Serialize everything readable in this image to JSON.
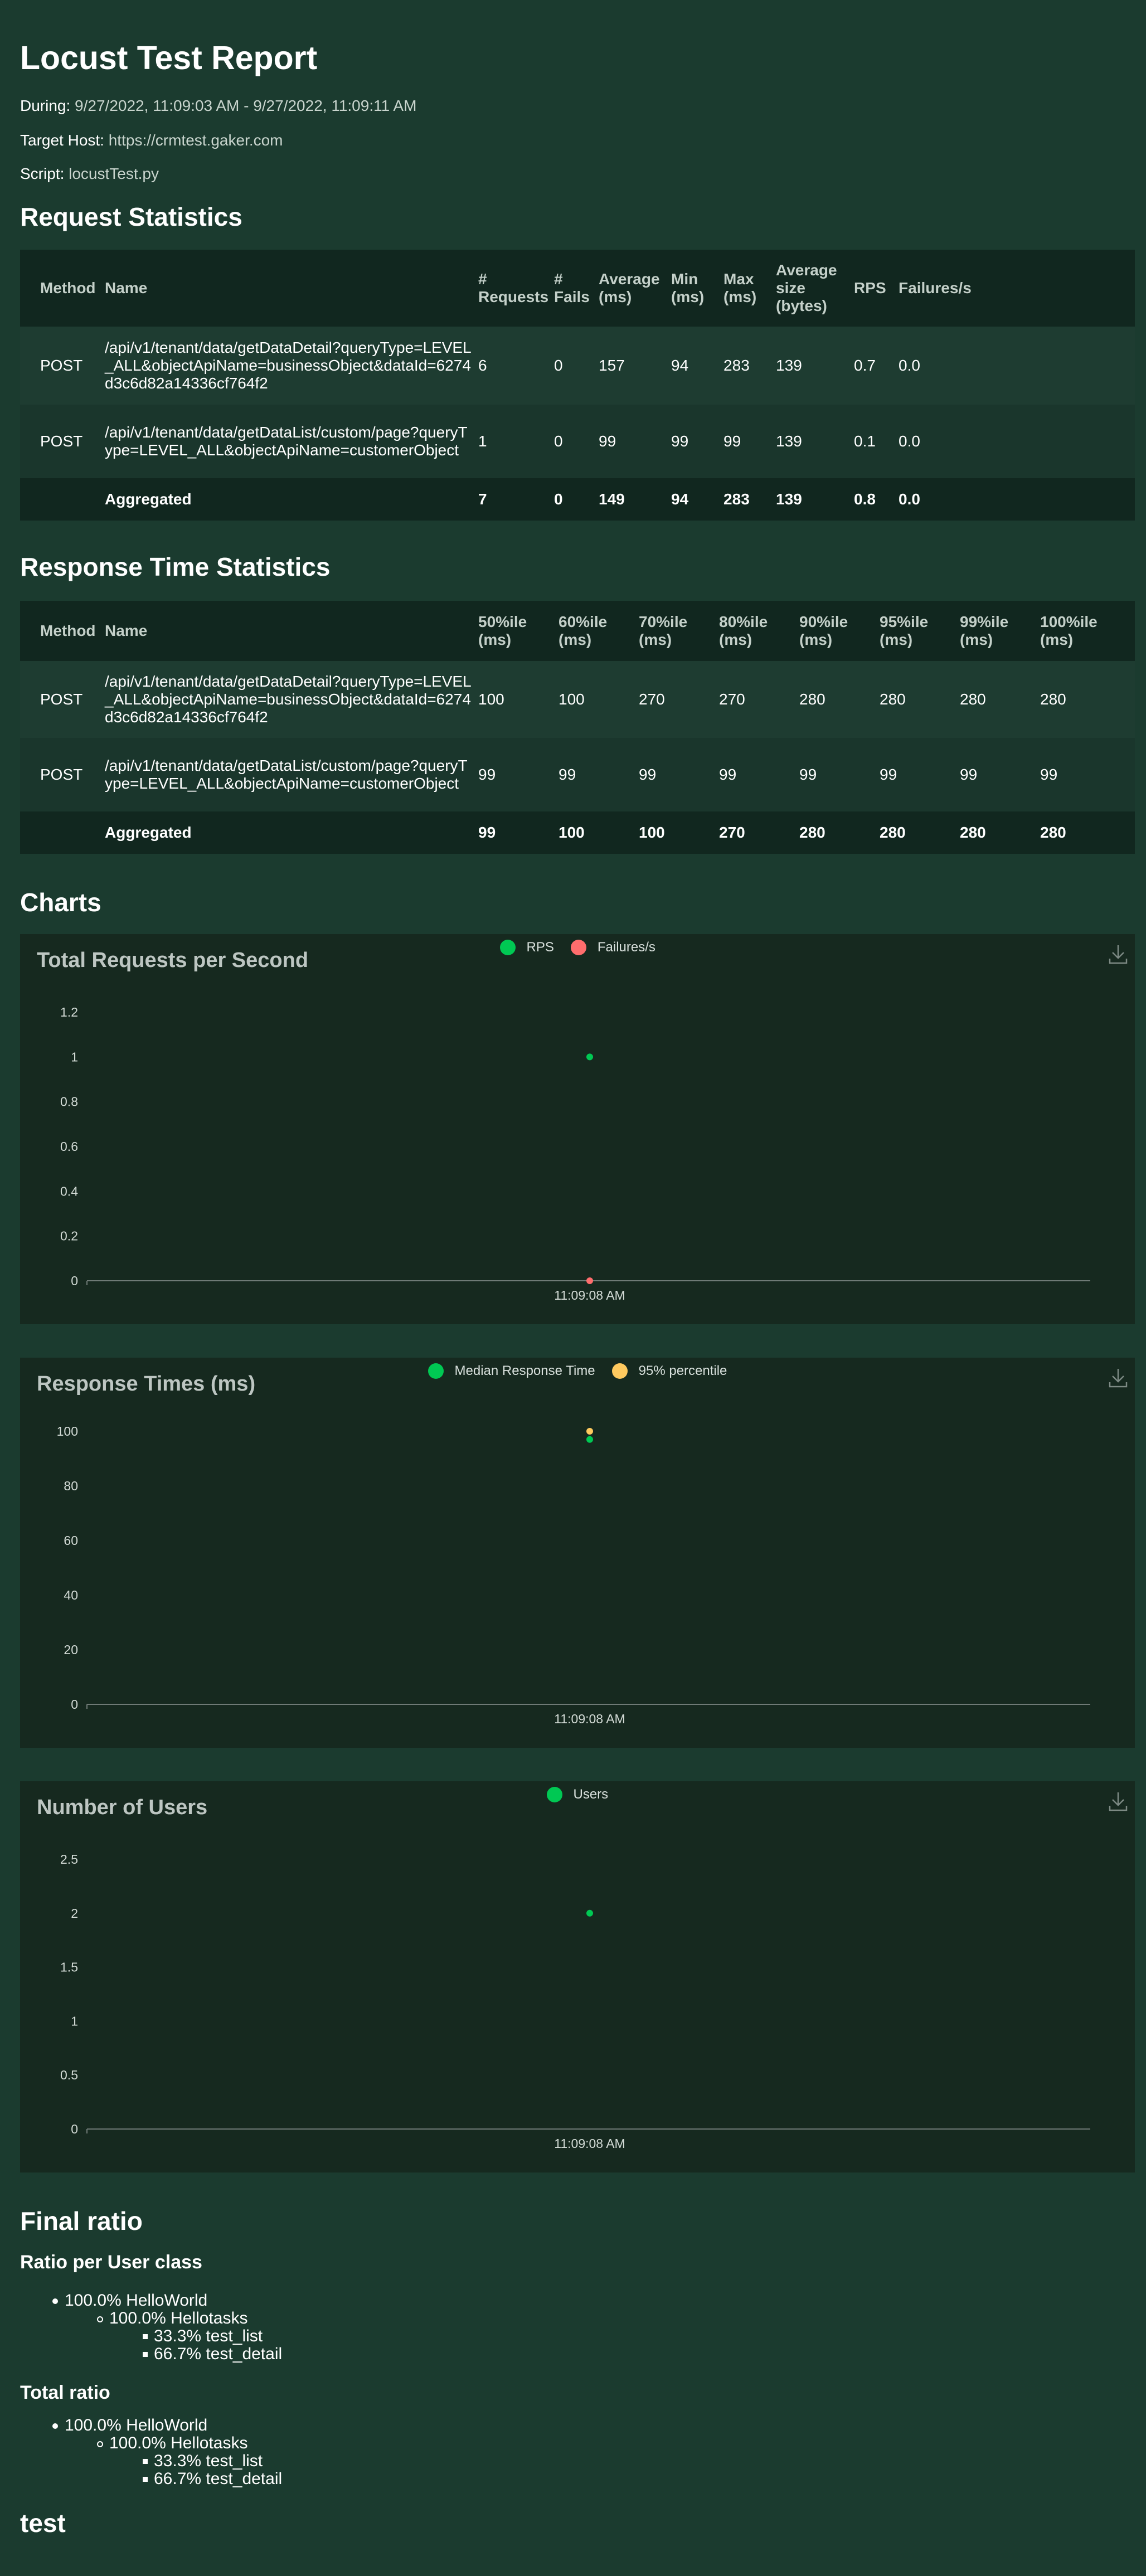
{
  "report": {
    "title": "Locust Test Report",
    "during_label": "During:",
    "during_value": "9/27/2022, 11:09:03 AM - 9/27/2022, 11:09:11 AM",
    "host_label": "Target Host:",
    "host_value": "https://crmtest.gaker.com",
    "script_label": "Script:",
    "script_value": "locustTest.py"
  },
  "request_stats": {
    "heading": "Request Statistics",
    "headers": [
      "Method",
      "Name",
      "# Requests",
      "# Fails",
      "Average (ms)",
      "Min (ms)",
      "Max (ms)",
      "Average size (bytes)",
      "RPS",
      "Failures/s"
    ],
    "rows": [
      [
        "POST",
        "/api/v1/tenant/data/getDataDetail?queryType=LEVEL_ALL&objectApiName=businessObject&dataId=6274d3c6d82a14336cf764f2",
        "6",
        "0",
        "157",
        "94",
        "283",
        "139",
        "0.7",
        "0.0"
      ],
      [
        "POST",
        "/api/v1/tenant/data/getDataList/custom/page?queryType=LEVEL_ALL&objectApiName=customerObject",
        "1",
        "0",
        "99",
        "99",
        "99",
        "139",
        "0.1",
        "0.0"
      ]
    ],
    "aggregated": [
      "",
      "Aggregated",
      "7",
      "0",
      "149",
      "94",
      "283",
      "139",
      "0.8",
      "0.0"
    ]
  },
  "response_stats": {
    "heading": "Response Time Statistics",
    "headers": [
      "Method",
      "Name",
      "50%ile (ms)",
      "60%ile (ms)",
      "70%ile (ms)",
      "80%ile (ms)",
      "90%ile (ms)",
      "95%ile (ms)",
      "99%ile (ms)",
      "100%ile (ms)"
    ],
    "rows": [
      [
        "POST",
        "/api/v1/tenant/data/getDataDetail?queryType=LEVEL_ALL&objectApiName=businessObject&dataId=6274d3c6d82a14336cf764f2",
        "100",
        "100",
        "270",
        "270",
        "280",
        "280",
        "280",
        "280"
      ],
      [
        "POST",
        "/api/v1/tenant/data/getDataList/custom/page?queryType=LEVEL_ALL&objectApiName=customerObject",
        "99",
        "99",
        "99",
        "99",
        "99",
        "99",
        "99",
        "99"
      ]
    ],
    "aggregated": [
      "",
      "Aggregated",
      "99",
      "100",
      "100",
      "270",
      "280",
      "280",
      "280",
      "280"
    ]
  },
  "charts_heading": "Charts",
  "chart_data": [
    {
      "type": "line",
      "title": "Total Requests per Second",
      "x": [
        "11:09:08 AM"
      ],
      "series": [
        {
          "name": "RPS",
          "values": [
            1
          ],
          "color": "#00c853"
        },
        {
          "name": "Failures/s",
          "values": [
            0
          ],
          "color": "#ff6d6d"
        }
      ],
      "yticks": [
        "0",
        "0.2",
        "0.4",
        "0.6",
        "0.8",
        "1",
        "1.2"
      ],
      "ylim": [
        0,
        1.2
      ],
      "legend": "top-center"
    },
    {
      "type": "line",
      "title": "Response Times (ms)",
      "x": [
        "11:09:08 AM"
      ],
      "series": [
        {
          "name": "Median Response Time",
          "values": [
            97
          ],
          "color": "#00c853"
        },
        {
          "name": "95% percentile",
          "values": [
            100
          ],
          "color": "#ffca5f"
        }
      ],
      "yticks": [
        "0",
        "20",
        "40",
        "60",
        "80",
        "100"
      ],
      "ylim": [
        0,
        100
      ],
      "legend": "top-center"
    },
    {
      "type": "line",
      "title": "Number of Users",
      "x": [
        "11:09:08 AM"
      ],
      "series": [
        {
          "name": "Users",
          "values": [
            2
          ],
          "color": "#00c853"
        }
      ],
      "yticks": [
        "0",
        "0.5",
        "1",
        "1.5",
        "2",
        "2.5"
      ],
      "ylim": [
        0,
        2.5
      ],
      "legend": "top-center"
    }
  ],
  "final_ratio": {
    "heading": "Final ratio",
    "per_class_heading": "Ratio per User class",
    "per_class": [
      {
        "text": "100.0% HelloWorld",
        "level": 1
      },
      {
        "text": "100.0% Hellotasks",
        "level": 2
      },
      {
        "text": "33.3% test_list",
        "level": 3
      },
      {
        "text": "66.7% test_detail",
        "level": 3
      }
    ],
    "total_heading": "Total ratio",
    "total": [
      {
        "text": "100.0% HelloWorld",
        "level": 1
      },
      {
        "text": "100.0% Hellotasks",
        "level": 2
      },
      {
        "text": "33.3% test_list",
        "level": 3
      },
      {
        "text": "66.7% test_detail",
        "level": 3
      }
    ]
  },
  "footer_heading": "test",
  "icons": {
    "download": "download-icon"
  }
}
